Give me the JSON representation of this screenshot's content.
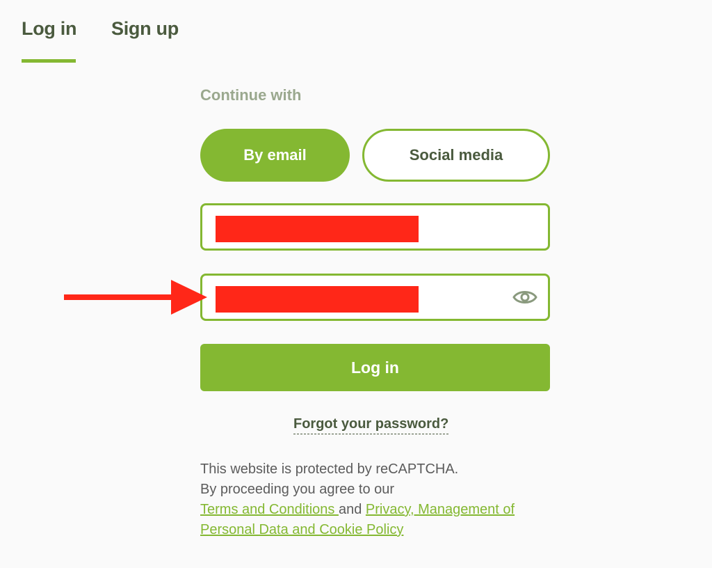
{
  "tabs": {
    "login": "Log in",
    "signup": "Sign up"
  },
  "form": {
    "continue_with": "Continue with",
    "by_email": "By email",
    "social_media": "Social media",
    "email_value": "",
    "password_value": "",
    "login_button": "Log in",
    "forgot_password": "Forgot your password?"
  },
  "legal": {
    "line1": "This website is protected by reCAPTCHA.",
    "line2": "By proceeding you agree to our",
    "terms_link": "Terms and Conditions ",
    "and": "and ",
    "privacy_link": "Privacy, Management of Personal Data and Cookie Policy"
  },
  "icons": {
    "show_password": "eye-icon",
    "annotation": "red-arrow-icon"
  },
  "colors": {
    "accent": "#84b832",
    "text_dark": "#4a5a3e",
    "text_muted": "#9aa88e",
    "redaction": "#ff2718"
  }
}
